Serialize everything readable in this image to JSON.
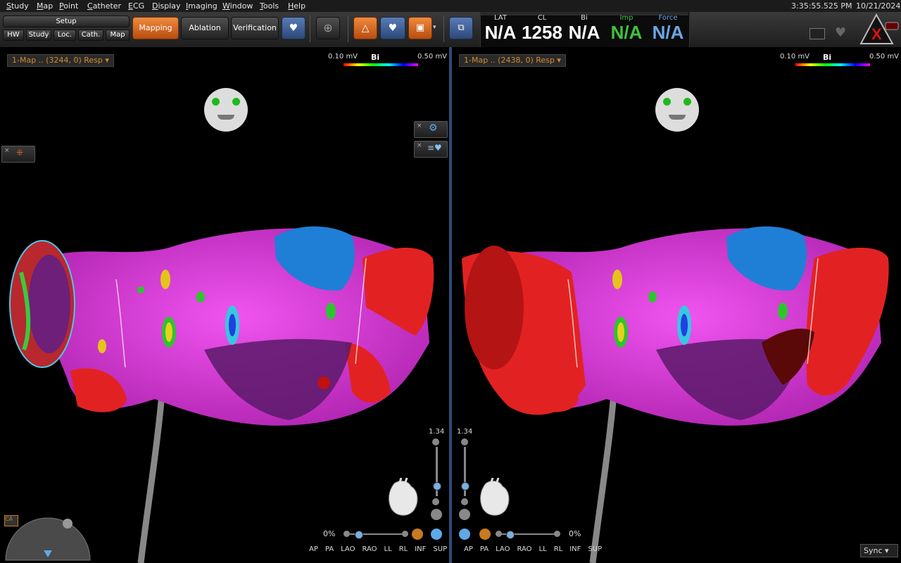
{
  "menu": [
    "Study",
    "Map",
    "Point",
    "Catheter",
    "ECG",
    "Display",
    "Imaging",
    "Window",
    "Tools",
    "Help"
  ],
  "setup": {
    "label": "Setup",
    "buttons": [
      "HW",
      "Study",
      "Loc.",
      "Cath.",
      "Map"
    ]
  },
  "workflow": {
    "mapping": "Mapping",
    "ablation": "Ablation",
    "verification": "Verification"
  },
  "readouts": [
    {
      "label": "LAT",
      "value": "N/A",
      "color": "#ffffff"
    },
    {
      "label": "CL",
      "value": "1258",
      "color": "#ffffff"
    },
    {
      "label": "Bi",
      "value": "N/A",
      "color": "#ffffff"
    },
    {
      "label": "Imp",
      "value": "N/A",
      "color": "#3ec43e"
    },
    {
      "label": "Force",
      "value": "N/A",
      "color": "#6aa7e8"
    }
  ],
  "clock": {
    "time": "3:35:55.525 PM",
    "date": "10/21/2024"
  },
  "left": {
    "map_name": "1-Map .. (3244, 0) Resp",
    "scale_min": "0.10 mV",
    "scale_label": "Bi",
    "scale_max": "0.50 mV",
    "zoom": "1.34",
    "percent": "0%",
    "views": [
      "AP",
      "PA",
      "LAO",
      "RAO",
      "LL",
      "RL",
      "INF",
      "SUP"
    ]
  },
  "right": {
    "map_name": "1-Map .. (2438, 0) Resp",
    "scale_min": "0.10 mV",
    "scale_label": "Bi",
    "scale_max": "0.50 mV",
    "zoom": "1.34",
    "percent": "0%",
    "views": [
      "AP",
      "PA",
      "LAO",
      "RAO",
      "LL",
      "RL",
      "INF",
      "SUP"
    ]
  },
  "sync": "Sync",
  "colors": {
    "mapping": "#e0772b",
    "map_name": "#d18b2b",
    "magenta": "#d93ad9",
    "red": "#e52020",
    "blue": "#1f7fd6"
  }
}
